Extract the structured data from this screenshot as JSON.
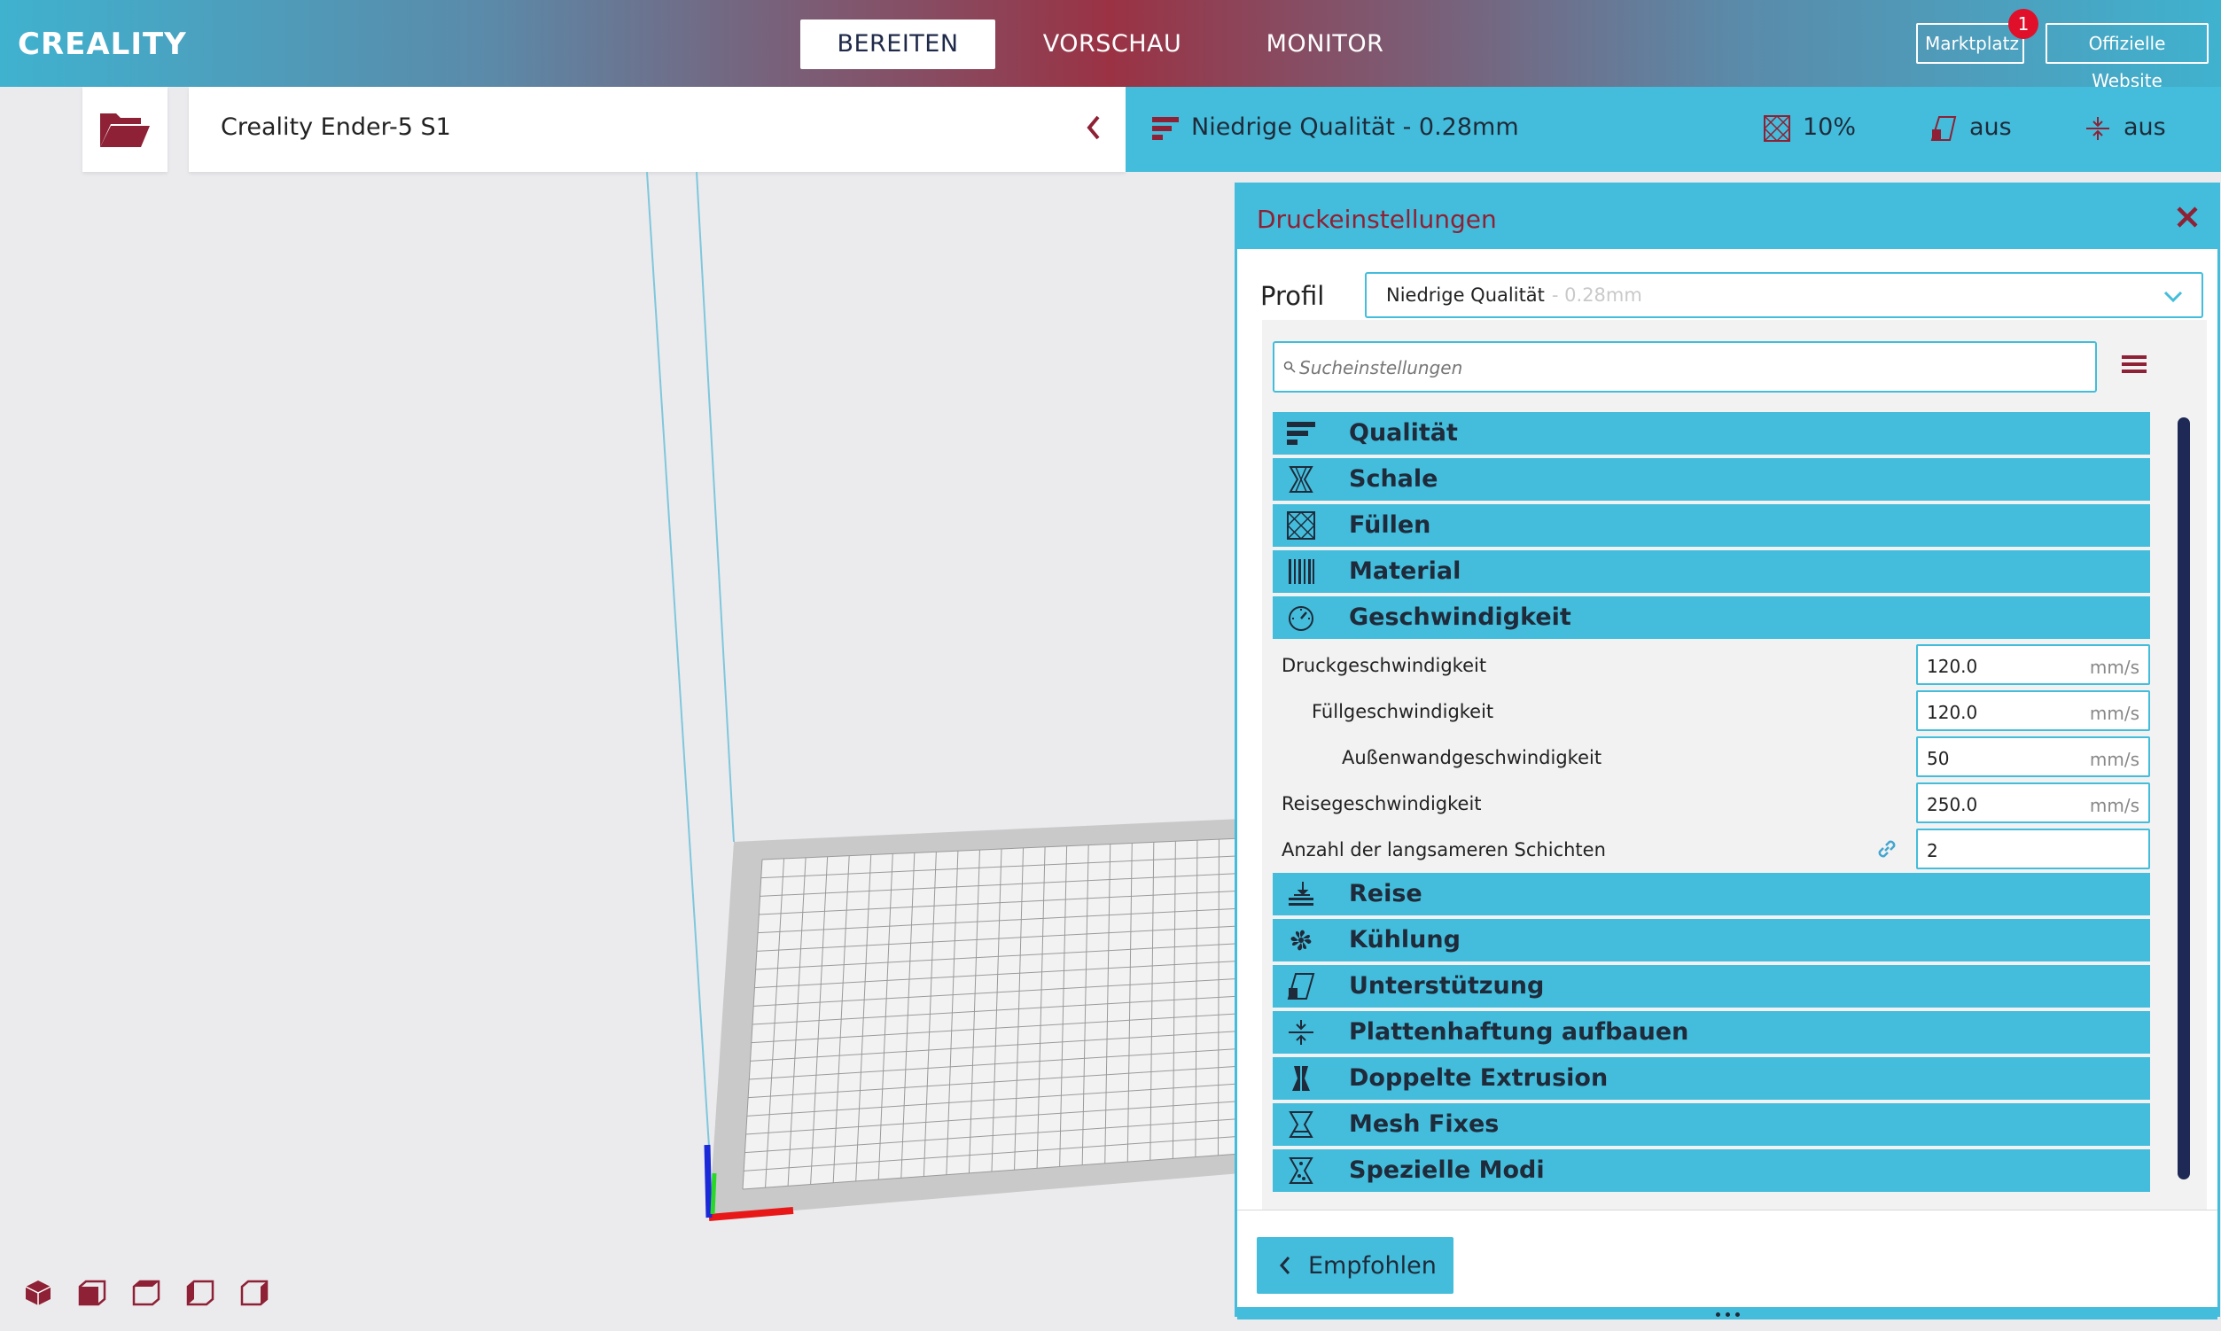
{
  "app": {
    "logo": "CREALITY",
    "stages": [
      {
        "label": "BEREITEN",
        "active": true
      },
      {
        "label": "VORSCHAU",
        "active": false
      },
      {
        "label": "MONITOR",
        "active": false
      }
    ],
    "marketplace_label": "Marktplatz",
    "marketplace_badge": "1",
    "website_label": "Offizielle Website"
  },
  "machine": {
    "name": "Creality Ender-5 S1"
  },
  "print_bar": {
    "profile": "Niedrige Qualität - 0.28mm",
    "infill": "10%",
    "support": "aus",
    "adhesion": "aus"
  },
  "panel": {
    "title": "Druckeinstellungen",
    "profile_label": "Profil",
    "profile_name": "Niedrige Qualität",
    "profile_layer": "- 0.28mm",
    "search_placeholder": "Sucheinstellungen",
    "categories_top": [
      {
        "label": "Qualität",
        "icon": "quality-icon"
      },
      {
        "label": "Schale",
        "icon": "shell-icon"
      },
      {
        "label": "Füllen",
        "icon": "infill-icon"
      },
      {
        "label": "Material",
        "icon": "material-icon"
      },
      {
        "label": "Geschwindigkeit",
        "icon": "speed-icon"
      }
    ],
    "speed_settings": [
      {
        "label": "Druckgeschwindigkeit",
        "value": "120.0",
        "unit": "mm/s",
        "indent": 0
      },
      {
        "label": "Füllgeschwindigkeit",
        "value": "120.0",
        "unit": "mm/s",
        "indent": 1
      },
      {
        "label": "Außenwandgeschwindigkeit",
        "value": "50",
        "unit": "mm/s",
        "indent": 2
      },
      {
        "label": "Reisegeschwindigkeit",
        "value": "250.0",
        "unit": "mm/s",
        "indent": 0
      },
      {
        "label": "Anzahl der langsameren Schichten",
        "value": "2",
        "unit": "",
        "indent": 0
      }
    ],
    "categories_bottom": [
      {
        "label": "Reise",
        "icon": "travel-icon"
      },
      {
        "label": "Kühlung",
        "icon": "cooling-fan-icon"
      },
      {
        "label": "Unterstützung",
        "icon": "support-icon"
      },
      {
        "label": "Plattenhaftung aufbauen",
        "icon": "adhesion-icon"
      },
      {
        "label": "Doppelte Extrusion",
        "icon": "dual-extrusion-icon"
      },
      {
        "label": "Mesh Fixes",
        "icon": "mesh-fix-icon"
      },
      {
        "label": "Spezielle Modi",
        "icon": "special-modes-icon"
      }
    ],
    "recommend_label": "Empfohlen"
  },
  "colors": {
    "accent": "#43bddb",
    "brand": "#8e2135",
    "dark": "#1f2a3a"
  }
}
